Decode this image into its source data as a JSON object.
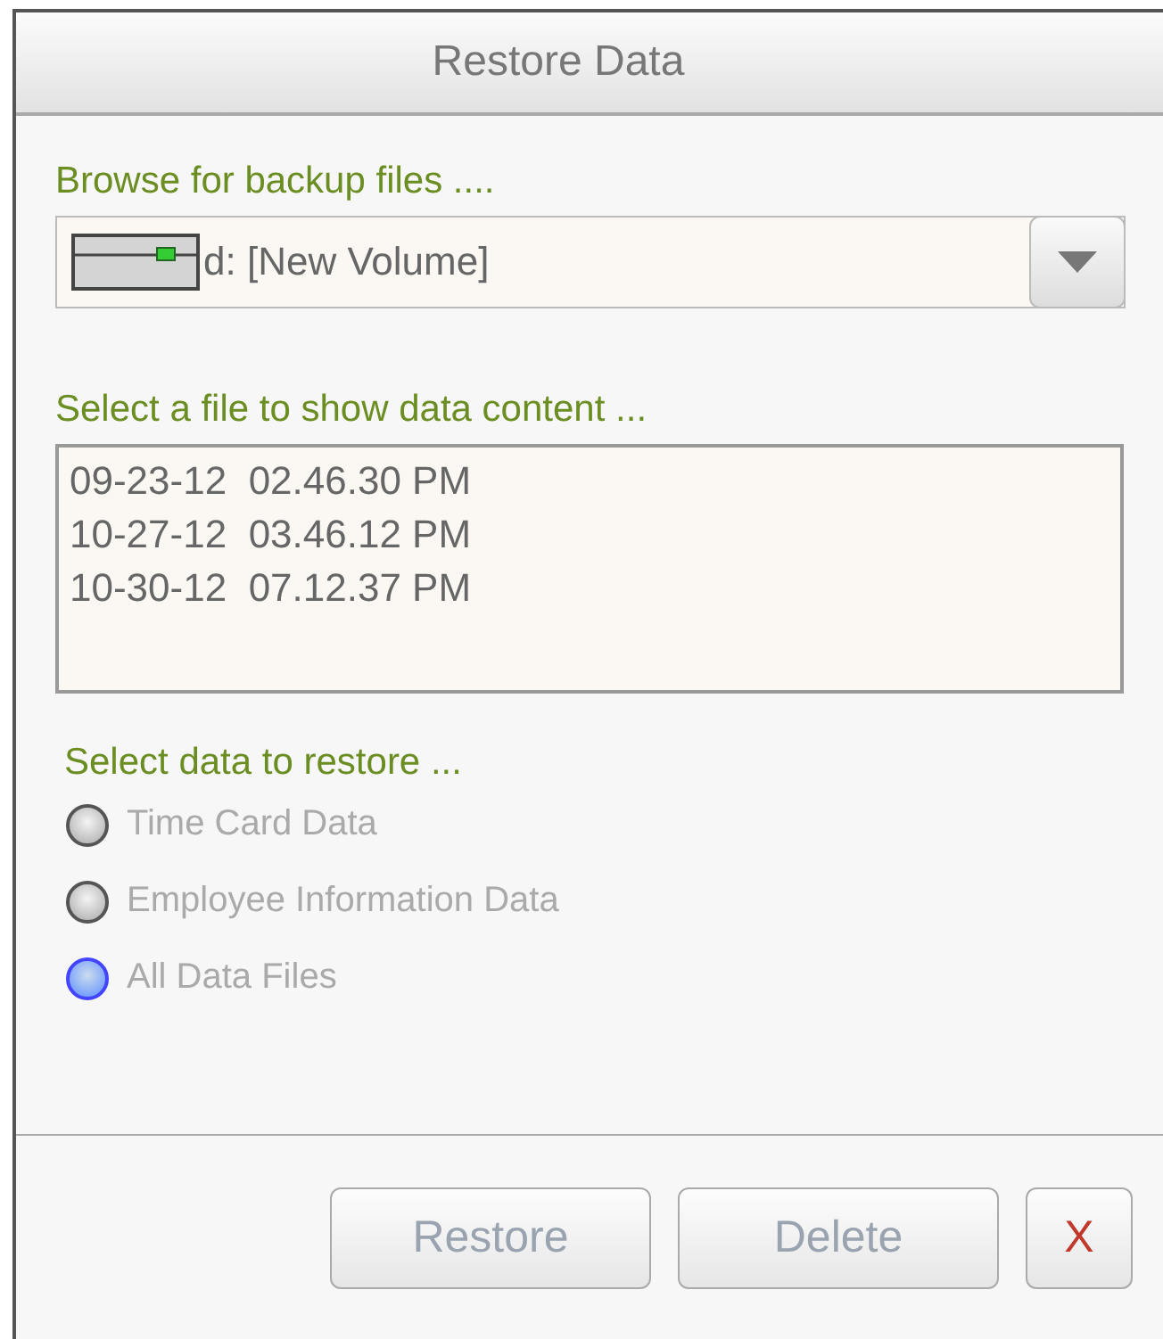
{
  "window": {
    "title": "Restore Data"
  },
  "browse": {
    "label": "Browse for backup files ....",
    "value": "d: [New Volume]"
  },
  "files": {
    "label": "Select a file to show data content ...",
    "items": [
      {
        "date": "09-23-12",
        "time": "02.46.30 PM"
      },
      {
        "date": "10-27-12",
        "time": "03.46.12 PM"
      },
      {
        "date": "10-30-12",
        "time": "07.12.37 PM"
      }
    ]
  },
  "restore_options": {
    "label": "Select data to restore ...",
    "items": [
      {
        "label": "Time Card Data",
        "selected": false
      },
      {
        "label": "Employee Information Data",
        "selected": false
      },
      {
        "label": "All Data Files",
        "selected": true
      }
    ]
  },
  "buttons": [
    {
      "label": "Restore",
      "kind": "action",
      "disabled": true
    },
    {
      "label": "Delete",
      "kind": "action",
      "disabled": true
    },
    {
      "label": "X",
      "kind": "close",
      "disabled": false
    }
  ]
}
